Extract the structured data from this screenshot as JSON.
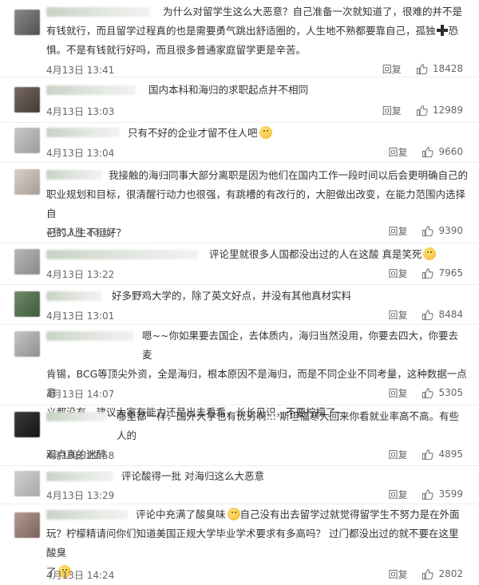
{
  "comments": [
    {
      "text_lines": [
        "为什么对留学生这么大恶意？自己准备一次就知道了，很难的并不是",
        "有钱就行，而且留学过程真的也是需要勇气跳出舒适圈的，人生地不熟都要靠自己，孤独",
        "惧。不是有钱就行好吗，而且很多普通家庭留学更是辛苦。"
      ],
      "text_suffix": "恐",
      "time": "4月13日 13:41",
      "reply": "回复",
      "likes": "18428"
    },
    {
      "text_lines": [
        "国内本科和海归的求职起点并不相同"
      ],
      "time": "4月13日 13:03",
      "reply": "回复",
      "likes": "12989"
    },
    {
      "text_lines": [
        "只有不好的企业才留不住人吧"
      ],
      "time": "4月13日 13:04",
      "reply": "回复",
      "likes": "9660"
    },
    {
      "text_lines": [
        "我接触的海归同事大部分离职是因为他们在国内工作一段时间以后会更明确自己的",
        "职业规划和目标，很清醒行动力也很强，有跳槽的有改行的，大胆做出改变，在能力范围内选择自",
        "己的人生不挺好？"
      ],
      "time": "4月13日 13:17",
      "reply": "回复",
      "likes": "9390"
    },
    {
      "text_lines": [
        "评论里就很多人国都没出过的人在这酸 真是笑死"
      ],
      "time": "4月13日 13:22",
      "reply": "回复",
      "likes": "7965"
    },
    {
      "text_lines": [
        "好多野鸡大学的，除了英文好点，并没有其他真材实料"
      ],
      "time": "4月13日 13:01",
      "reply": "回复",
      "likes": "8484"
    },
    {
      "text_lines": [
        "嗯~~你如果要去国企，去体质内，海归当然没用，你要去四大，你要去麦",
        "肯锡，BCG等顶尖外资，全是海归，根本原因不是海归，而是不同企业不同考量，这种数据一点意",
        "义都没有，建议大家有能力还是出去看看，长长见识，不要柠檬了~"
      ],
      "time": "4月13日 14:07",
      "reply": "回复",
      "likes": "5305"
    },
    {
      "text_lines": [
        "哪里都一样，国外大学也有优劣啊… 斯坦福寒大回来你看就业率高不高。有些人的",
        "观点真的迷醉"
      ],
      "time": "4月13日 12:58",
      "reply": "回复",
      "likes": "4895"
    },
    {
      "text_lines": [
        "评论酸得一批 对海归这么大恶意"
      ],
      "time": "4月13日 13:29",
      "reply": "回复",
      "likes": "3599"
    },
    {
      "text_lines": [
        "评论中充满了酸臭味",
        "自己没有出去留学过就觉得留学生不努力是在外面",
        "玩？柠檬精请问你们知道美国正规大学毕业学术要求有多高吗？ 过门都没出过的就不要在这里酸臭",
        "了"
      ],
      "time": "4月13日 14:24",
      "reply": "回复",
      "likes": "2802"
    }
  ],
  "icons": {
    "like": "thumbs-up-icon",
    "emoji": "smiley-emoji-icon",
    "cross": "cross-emoji-icon"
  },
  "colors": {
    "text": "#333333",
    "meta": "#666666",
    "divider": "#eeeeee"
  }
}
